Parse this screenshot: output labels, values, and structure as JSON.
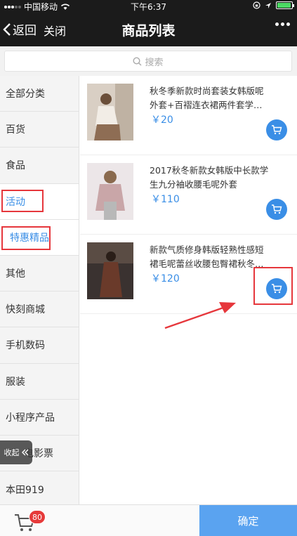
{
  "status_bar": {
    "carrier": "中国移动",
    "time": "下午6:37",
    "battery_level": 0.95
  },
  "nav": {
    "back_label": "返回",
    "close_label": "关闭",
    "title": "商品列表"
  },
  "search": {
    "placeholder": "搜索"
  },
  "categories": [
    {
      "label": "全部分类"
    },
    {
      "label": "百货"
    },
    {
      "label": "食品"
    },
    {
      "label": "活动"
    },
    {
      "label": "特惠精品"
    },
    {
      "label": "其他"
    },
    {
      "label": "快刻商城"
    },
    {
      "label": "手机数码"
    },
    {
      "label": "服装"
    },
    {
      "label": "小程序产品"
    },
    {
      "label": "电影票"
    },
    {
      "label": "本田919"
    }
  ],
  "collapse_label": "收起",
  "products": [
    {
      "name": "秋冬季新款时尚套装女韩版呢外套+百褶连衣裙两件套学…",
      "price": "￥20"
    },
    {
      "name": "2017秋冬新款女韩版中长款学生九分袖收腰毛呢外套",
      "price": "￥110"
    },
    {
      "name": "新款气质修身韩版轻熟性感短裙毛呢蕾丝收腰包臀裙秋冬…",
      "price": "￥120"
    }
  ],
  "footer": {
    "cart_count": "80",
    "confirm_label": "确定"
  },
  "colors": {
    "accent": "#3a8ee6",
    "highlight": "#e6373c",
    "nav_bg": "#1b1b1b"
  }
}
